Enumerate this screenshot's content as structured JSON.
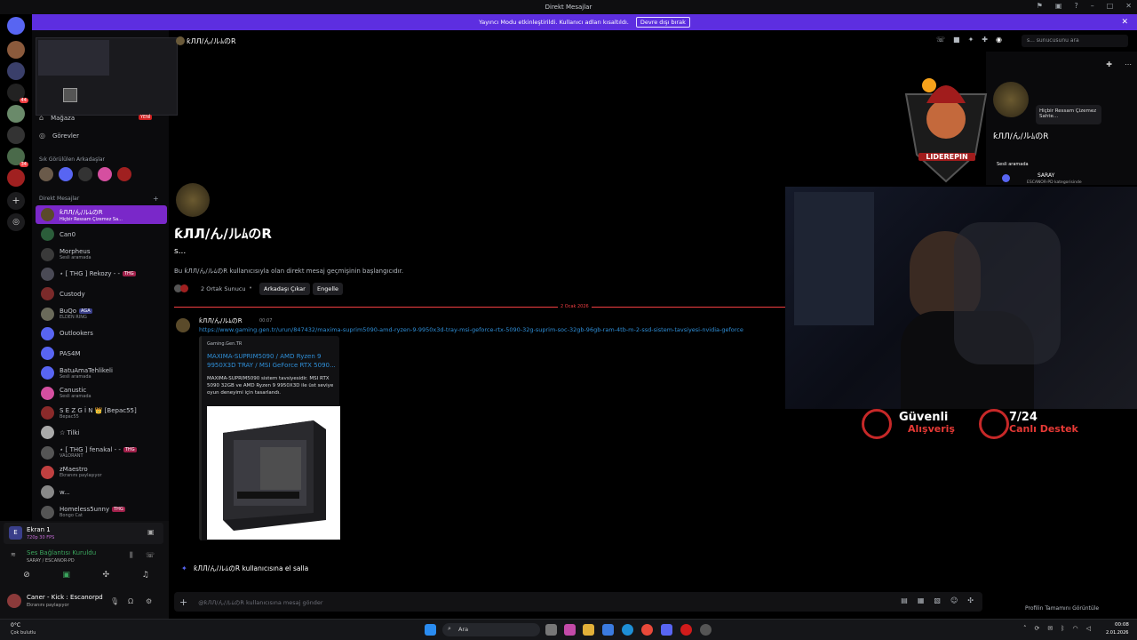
{
  "window": {
    "title": "Direkt Mesajlar"
  },
  "banner": {
    "text": "Yayıncı Modu etkinleştirildi. Kullanıcı adları kısaltıldı.",
    "button": "Devre dışı bırak"
  },
  "rail": {
    "badges": [
      "44",
      "34"
    ]
  },
  "sidebar": {
    "store": "Mağaza",
    "store_badge": "YENİ",
    "tasks": "Görevler",
    "frequent_heading": "Sık Görülülen Arkadaşlar",
    "dm_heading": "Direkt Mesajlar",
    "dms": [
      {
        "name": "ƙЛЛ/ん/ルﾑのR",
        "sub": "Hiçbir Ressam Çizemez Sa...",
        "active": true,
        "color": "#5a4a2a"
      },
      {
        "name": "Can0",
        "sub": "",
        "color": "#2b5d3a"
      },
      {
        "name": "Morpheus",
        "sub": "Sesli aramada",
        "color": "#3a3a3a"
      },
      {
        "name": "⋆ [ THG ] Rekozy - -",
        "sub": "",
        "tag": "THG",
        "color": "#4a4a55"
      },
      {
        "name": "Custody",
        "sub": "",
        "color": "#7a2a2a"
      },
      {
        "name": "BuQo",
        "sub": "ELDEN RING",
        "tag": "AGA",
        "color": "#6a6a5a"
      },
      {
        "name": "Outlookers",
        "sub": "",
        "color": "#5865f2"
      },
      {
        "name": "PAS4M",
        "sub": "",
        "color": "#5865f2"
      },
      {
        "name": "BatuAmaTehlikeli",
        "sub": "Sesli aramada",
        "color": "#5865f2"
      },
      {
        "name": "Canustic",
        "sub": "Sesli aramada",
        "color": "#d54fa0"
      },
      {
        "name": "S E Z G İ N 👑 [Bepac55]",
        "sub": "Bepac55",
        "color": "#8a2a2a"
      },
      {
        "name": "☆ Tilki",
        "sub": "",
        "color": "#aaa"
      },
      {
        "name": "⋆ [ THG ] fenakal - -",
        "sub": "VALORANT",
        "tag": "THG",
        "color": "#555"
      },
      {
        "name": "zMaestro",
        "sub": "Ekranını paylaşıyor",
        "color": "#c04040"
      },
      {
        "name": "w...",
        "sub": "",
        "color": "#888"
      },
      {
        "name": "Homeless5unny",
        "sub": "Bongo Cat",
        "tag": "THG",
        "color": "#555"
      }
    ]
  },
  "userpanel": {
    "screen_title": "Ekran 1",
    "screen_sub": "720p 30 FPS",
    "voice_status": "Ses Bağlantısı Kuruldu",
    "voice_channel": "SARAY / ESCANOR-PD",
    "user_name": "Caner - Kick : Escanorpd",
    "user_status": "Ekranını paylaşıyor"
  },
  "header": {
    "name": "ƙЛЛ/ん/ルﾑのR",
    "search_placeholder": "s... sunucusunu ara"
  },
  "intro": {
    "name": "ƙЛЛ/ん/ルﾑのR",
    "tag": "s...",
    "desc": "Bu ƙЛЛ/ん/ルﾑのR kullanıcısıyla olan direkt mesaj geçmişinin başlangıcıdır.",
    "mutual": "2 Ortak Sunucu",
    "remove_friend": "Arkadaşı Çıkar",
    "block": "Engelle"
  },
  "divider": {
    "date": "2 Ocak 2026"
  },
  "message": {
    "author": "ƙЛЛ/ん/ルﾑのR",
    "time": "00:07",
    "url": "https://www.gaming.gen.tr/urun/847432/maxima-suprim5090-amd-ryzen-9-9950x3d-tray-msi-geforce-rtx-5090-32g-suprim-soc-32gb-96gb-ram-4tb-m-2-ssd-sistem-tavsiyesi-nvidia-geforce",
    "embed_site": "Gaming.Gen.TR",
    "embed_title": "MAXIMA-SUPRIM5090 / AMD Ryzen 9 9950X3D TRAY / MSI GeForce RTX 5090...",
    "embed_desc": "MAXIMA-SUPRIM5090 sistem tavsiyesidir. MSI RTX 5090 32GB ve AMD Ryzen 9 9950X3D ile üst seviye oyun deneyimi için tasarlandı."
  },
  "wave": {
    "text": "ƙЛЛ/ん/ルﾑのR kullanıcısına el salla"
  },
  "composer": {
    "placeholder": "@ƙЛЛ/ん/ルﾑのR kullanıcısına mesaj gönder"
  },
  "profile": {
    "bio": "Hiçbir Ressam Çizemez Sahte...",
    "name": "ƙЛЛ/ん/ルﾑのR",
    "voice_label": "Sesli aramada",
    "voice_channel": "SARAY",
    "voice_sub": "ESCANOR-PD kategorisinde",
    "full_profile": "Profilin Tamamını Görüntüle"
  },
  "overlay": {
    "logo_text": "LIDERЕPIN",
    "promo1_a": "Güvenli",
    "promo1_b": "Alışveriş",
    "promo2_a": "7/24",
    "promo2_b": "Canlı Destek"
  },
  "taskbar": {
    "weather_temp": "0°C",
    "weather_desc": "Çok bulutlu",
    "search": "Ara",
    "time": "00:08",
    "date": "2.01.2026"
  },
  "colors": {
    "accent": "#5d2ee0",
    "active_dm": "#7a28c9",
    "link": "#2f8fd8",
    "divider": "#f23f43"
  }
}
